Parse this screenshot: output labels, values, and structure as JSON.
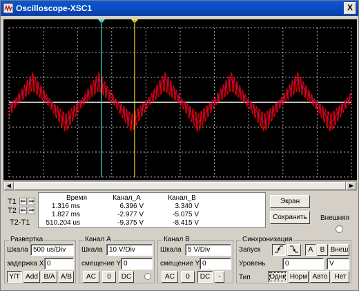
{
  "window": {
    "title": "Oscilloscope-XSC1",
    "close_label": "X"
  },
  "colors": {
    "channel_a": "#ff0000",
    "channel_b": "#2020ff",
    "cursor1": "#40e0e0",
    "cursor2": "#f0e020",
    "grid": "#ffffff",
    "screen_bg": "#000000"
  },
  "cursors": {
    "t1_label": "T1",
    "t2_label": "T2",
    "diff_label": "T2-T1",
    "t1_marker": "1",
    "t2_marker": "2"
  },
  "readout": {
    "headers": [
      "Время",
      "Канал_А",
      "Канал_В"
    ],
    "rows": [
      [
        "1.316 ms",
        "6.396 V",
        "3.340 V"
      ],
      [
        "1.827 ms",
        "-2.977 V",
        "-5.075 V"
      ],
      [
        "510.204 us",
        "-9.375 V",
        "-8.415 V"
      ]
    ]
  },
  "buttons": {
    "screen": "Экран",
    "save": "Сохранить",
    "external": "Внешняя"
  },
  "timebase": {
    "title": "Развертка",
    "scale_label": "Шкала",
    "scale_value": "500 us/Div",
    "delay_label": "задержка X",
    "delay_value": "0",
    "modes": [
      "Y/T",
      "Add",
      "B/A",
      "A/B"
    ]
  },
  "channel_a": {
    "title": "Канал А",
    "scale_label": "Шкала",
    "scale_value": "10  V/Div",
    "offset_label": "смещение Y",
    "offset_value": "0",
    "couplings": [
      "AC",
      "0",
      "DC"
    ]
  },
  "channel_b": {
    "title": "Канал В",
    "scale_label": "Шкала",
    "scale_value": "5  V/Div",
    "offset_label": "смещение Y",
    "offset_value": "0",
    "couplings": [
      "AC",
      "0",
      "DC",
      "-"
    ]
  },
  "trigger": {
    "title": "Синхронизация",
    "start_label": "Запуск",
    "edge_rise": "⨍",
    "edge_fall": "⨍",
    "sources": [
      "A",
      "B",
      "Внеш"
    ],
    "level_label": "Уровень",
    "level_value": "0",
    "level_unit": "V",
    "type_label": "Тип",
    "types": [
      "Однк",
      "Норм",
      "Авто",
      "Нет"
    ]
  }
}
